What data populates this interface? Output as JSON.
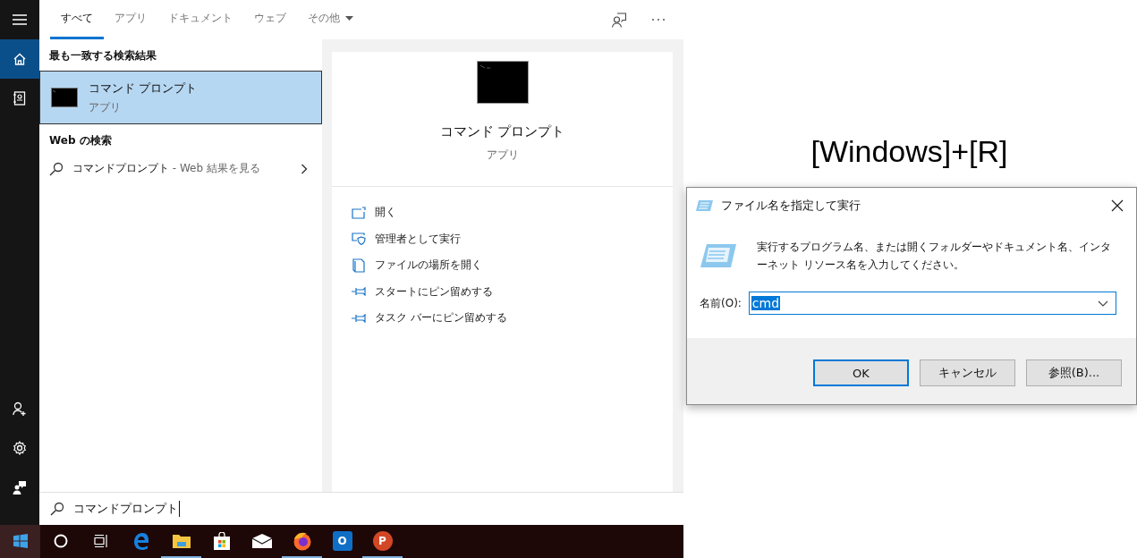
{
  "rail": {
    "top": [
      {
        "kind": "menu",
        "selected": false
      },
      {
        "kind": "home",
        "selected": true
      },
      {
        "kind": "notebook",
        "selected": false
      }
    ],
    "bottom": [
      {
        "kind": "person-add",
        "selected": false
      },
      {
        "kind": "settings",
        "selected": false
      },
      {
        "kind": "feedback",
        "selected": false
      }
    ]
  },
  "tabs": [
    {
      "label": "すべて",
      "selected": true,
      "dropdown": false
    },
    {
      "label": "アプリ",
      "selected": false,
      "dropdown": false
    },
    {
      "label": "ドキュメント",
      "selected": false,
      "dropdown": false
    },
    {
      "label": "ウェブ",
      "selected": false,
      "dropdown": false
    },
    {
      "label": "その他",
      "selected": false,
      "dropdown": true
    }
  ],
  "best_match": {
    "heading": "最も一致する検索結果",
    "title": "コマンド プロンプト",
    "subtitle": "アプリ",
    "selected": true
  },
  "web_search": {
    "heading": "Web の検索",
    "query": "コマンドプロンプト",
    "hint": " - Web 結果を見る"
  },
  "preview": {
    "title": "コマンド プロンプト",
    "subtitle": "アプリ",
    "actions": [
      {
        "kind": "open",
        "label": "開く"
      },
      {
        "kind": "admin",
        "label": "管理者として実行"
      },
      {
        "kind": "folder",
        "label": "ファイルの場所を開く"
      },
      {
        "kind": "pin",
        "label": "スタートにピン留めする"
      },
      {
        "kind": "pin",
        "label": "タスク バーにピン留めする"
      }
    ]
  },
  "search": {
    "value": "コマンドプロンプト"
  },
  "taskbar": [
    {
      "kind": "start",
      "running": false
    },
    {
      "kind": "cortana",
      "running": false
    },
    {
      "kind": "taskview",
      "running": false
    },
    {
      "kind": "edge",
      "running": false
    },
    {
      "kind": "explorer",
      "running": true
    },
    {
      "kind": "store",
      "running": false
    },
    {
      "kind": "mail",
      "running": false
    },
    {
      "kind": "firefox",
      "running": true
    },
    {
      "kind": "outlook",
      "running": false,
      "glyph": "O"
    },
    {
      "kind": "powerpoint",
      "running": true,
      "glyph": "P"
    }
  ],
  "shortcut": "[Windows]+[R]",
  "run_dialog": {
    "title": "ファイル名を指定して実行",
    "description": "実行するプログラム名、または開くフォルダーやドキュメント名、インターネット リソース名を入力してください。",
    "name_label": "名前(O):",
    "value": "cmd",
    "buttons": [
      {
        "label": "OK",
        "default": true
      },
      {
        "label": "キャンセル",
        "default": false
      },
      {
        "label": "参照(B)...",
        "default": false
      }
    ]
  }
}
